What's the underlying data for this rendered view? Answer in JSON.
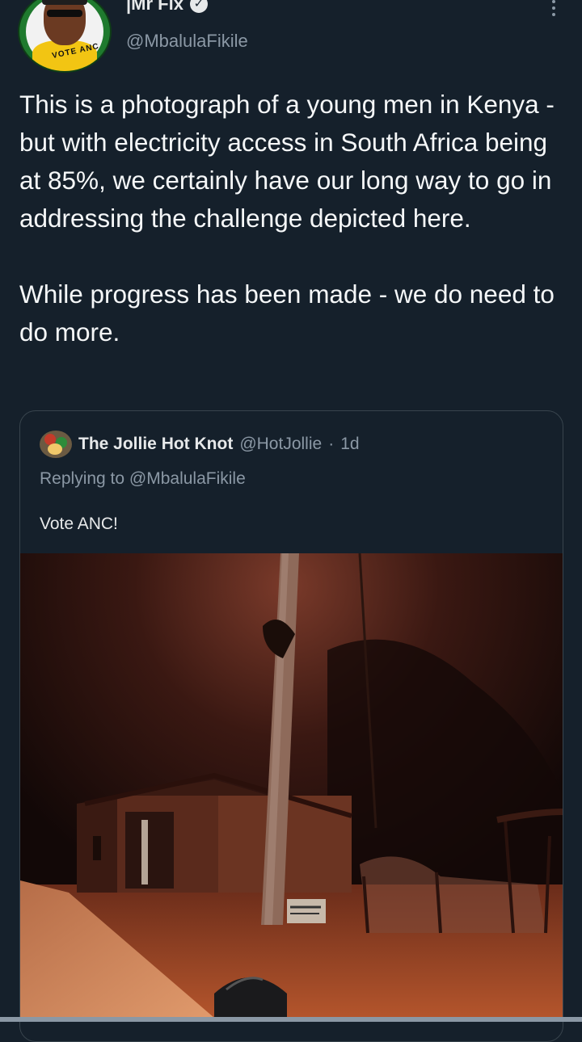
{
  "tweet": {
    "author_name": "|Mr Fix",
    "author_handle": "@MbalulaFikile",
    "avatar_text": "VOTE ANC",
    "text": "This is a photograph of a young men in Kenya - but with electricity access in South Africa being at 85%, we certainly have our long way to go in addressing the challenge depicted here.\n\nWhile progress has been made - we do need to do more."
  },
  "quoted_tweet": {
    "author_name": "The Jollie Hot Knot",
    "author_handle": "@HotJollie",
    "separator": "·",
    "time": "1d",
    "replying_label": "Replying to",
    "replying_to": "@MbalulaFikile",
    "text": "Vote ANC!",
    "image_sign_text": "SMALL ENTERPRISE"
  },
  "colors": {
    "background": "#15202b",
    "text_primary": "#e7e9ea",
    "text_secondary": "#8b98a5",
    "border": "#38444d"
  },
  "icons": {
    "verified": "verified-badge-icon",
    "more": "more-options-icon"
  }
}
